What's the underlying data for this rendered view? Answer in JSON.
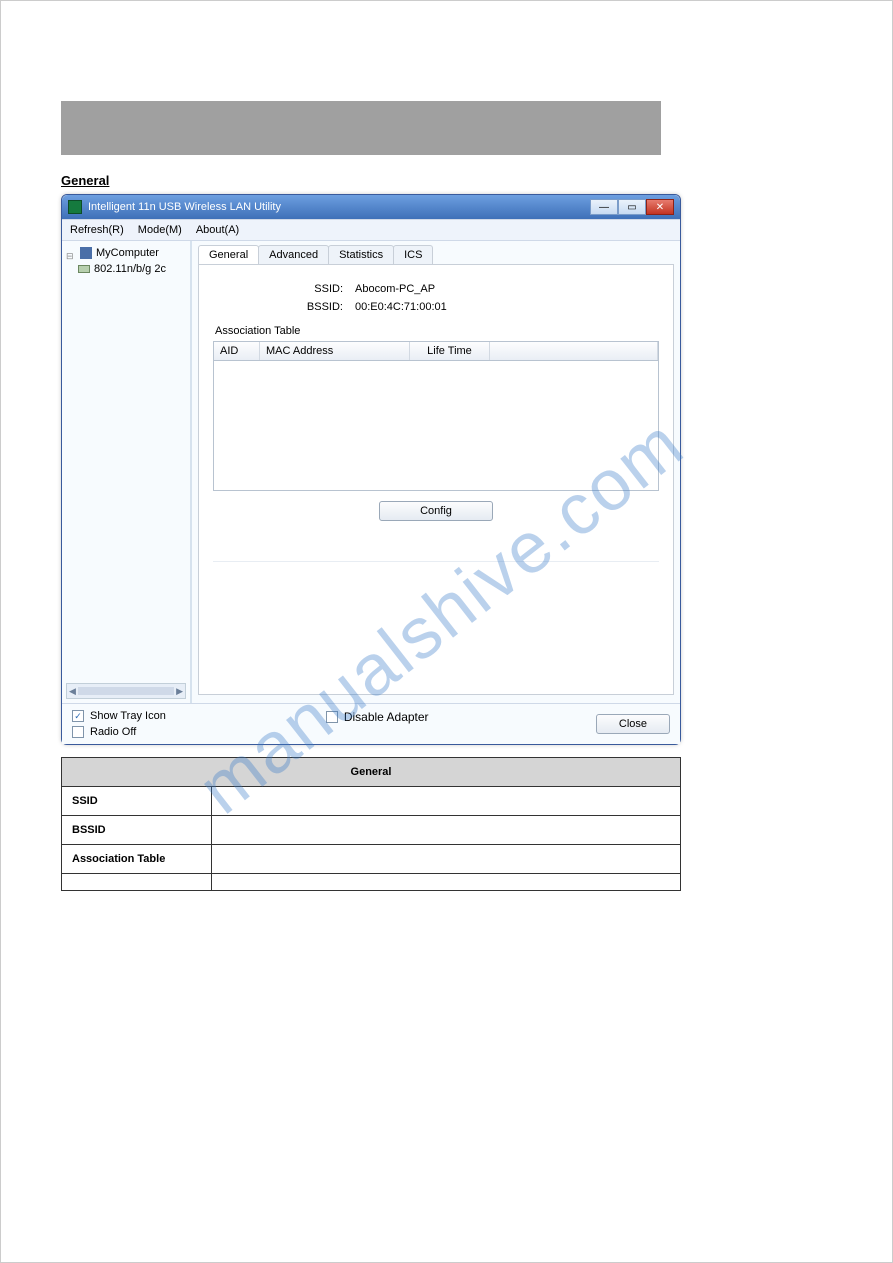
{
  "watermark": "manualshive.com",
  "section_heading": "General",
  "window": {
    "title": "Intelligent 11n USB Wireless LAN Utility",
    "menu": {
      "refresh": "Refresh(R)",
      "mode": "Mode(M)",
      "about": "About(A)"
    },
    "tree": {
      "root": "MyComputer",
      "child": "802.11n/b/g 2c"
    },
    "tabs": {
      "general": "General",
      "advanced": "Advanced",
      "statistics": "Statistics",
      "ics": "ICS"
    },
    "fields": {
      "ssid_label": "SSID:",
      "ssid_value": "Abocom-PC_AP",
      "bssid_label": "BSSID:",
      "bssid_value": "00:E0:4C:71:00:01"
    },
    "assoc_label": "Association Table",
    "assoc_headers": {
      "aid": "AID",
      "mac": "MAC Address",
      "life": "Life Time"
    },
    "config_btn": "Config",
    "bottom": {
      "show_tray": "Show Tray Icon",
      "radio_off": "Radio Off",
      "disable_adapter": "Disable Adapter",
      "close": "Close"
    }
  },
  "desc_table": {
    "header": "General",
    "rows": [
      {
        "left": "SSID",
        "right": ""
      },
      {
        "left": "BSSID",
        "right": ""
      },
      {
        "left": "Association Table",
        "right": ""
      },
      {
        "left": "",
        "right": ""
      }
    ]
  }
}
